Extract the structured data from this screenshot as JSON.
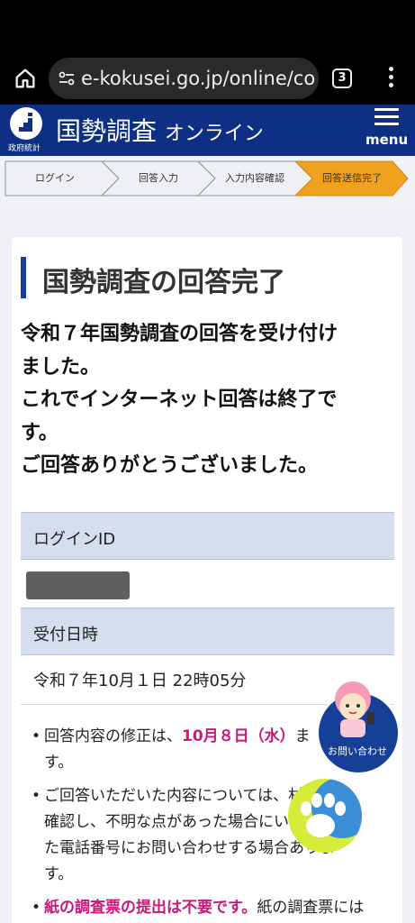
{
  "browser": {
    "url": "e-kokusei.go.jp/online/co",
    "tab_count": "3"
  },
  "header": {
    "logo_caption": "政府統計",
    "title": "国勢調査",
    "title_sub": "オンライン",
    "menu_label": "menu",
    "brand_color": "#0d2f84"
  },
  "steps": {
    "items": [
      "ログイン",
      "回答入力",
      "入力内容確認",
      "回答送信完了"
    ],
    "active_index": 3,
    "active_color": "#f0a21e"
  },
  "main": {
    "heading": "国勢調査の回答完了",
    "message_lines": [
      "令和７年国勢調査の回答を受け付け",
      "ました。",
      "これでインターネット回答は終了で",
      "す。",
      "ご回答ありがとうございました。"
    ],
    "login_id_label": "ログインID",
    "received_label": "受付日時",
    "received_value": "令和７年10月１日 22時05分",
    "notes": [
      {
        "prefix": "回答内容の修正は、",
        "emph": "10月８日（水）",
        "suffix": "ま",
        "cont": "す。"
      },
      {
        "lines": [
          "ご回答いただいた内容については、",
          "確認し、不明な点があった場合に",
          "た電話番号にお問い合わせする場合",
          "す。"
        ],
        "tail": [
          "村で",
          "いた",
          "ありま"
        ]
      },
      {
        "emph": "紙の調査票の提出は不要です。",
        "suffix": "紙の調査票には"
      }
    ]
  },
  "help_fab": {
    "label": "お問い合わせ",
    "color": "#163f97"
  },
  "paw_fab": {
    "color": "#d7eb3a"
  }
}
